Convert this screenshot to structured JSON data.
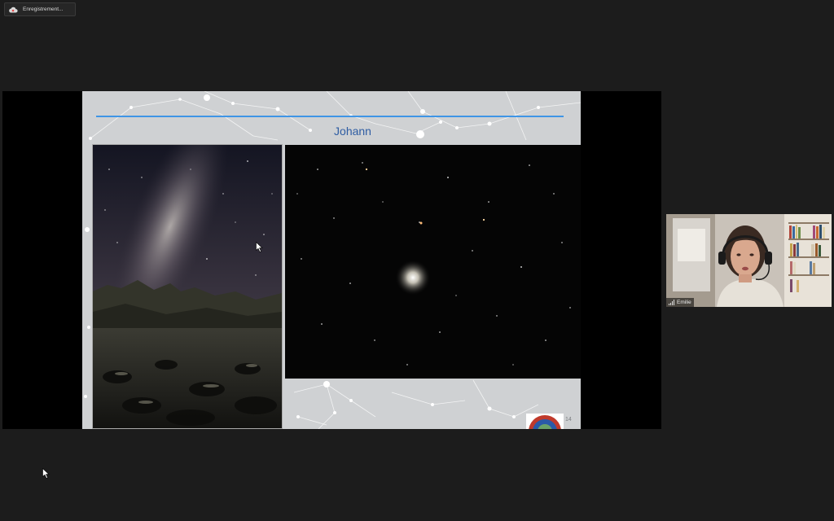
{
  "recording": {
    "label": "Enregistrement...",
    "icon": "cloud-record-icon"
  },
  "slide": {
    "title": "Johann",
    "page_number": "14",
    "accent_color": "#3f95e6",
    "title_color": "#2f5da3",
    "images": [
      "milky-way-landscape",
      "globular-cluster"
    ]
  },
  "participant": {
    "name": "Emilie",
    "icon": "signal-bars-icon"
  }
}
